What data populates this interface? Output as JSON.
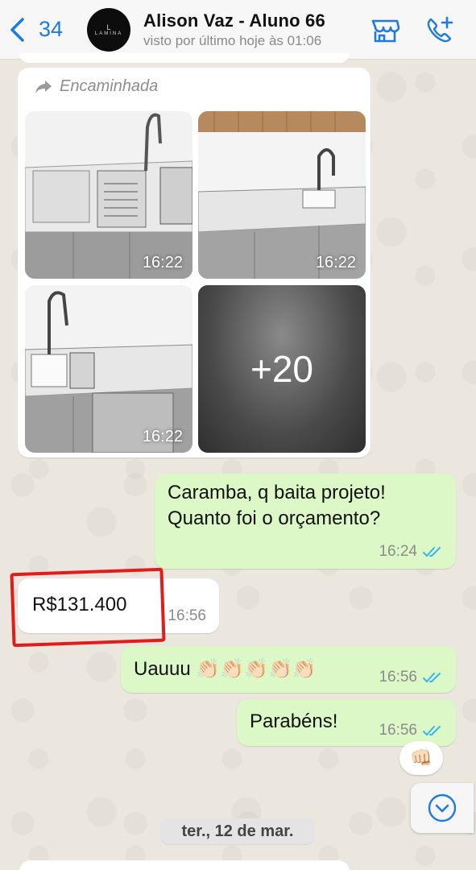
{
  "header": {
    "back_count": "34",
    "contact_name": "Alison Vaz - Aluno 66",
    "status": "visto por último hoje às 01:06",
    "avatar_mark": "L",
    "avatar_brand": "LAMINA",
    "icons": [
      "back-chevron-icon",
      "store-icon",
      "add-call-icon"
    ],
    "accent": "#1c7be0"
  },
  "forwarded": {
    "label": "Encaminhada",
    "images": [
      {
        "time": "16:22"
      },
      {
        "time": "16:22"
      },
      {
        "time": "16:22"
      }
    ],
    "more_label": "+20"
  },
  "messages": [
    {
      "dir": "out",
      "lines": [
        "Caramba, q baita projeto!",
        "Quanto foi o orçamento?"
      ],
      "time": "16:24",
      "read": true
    },
    {
      "dir": "in",
      "text": "R$131.400",
      "time": "16:56"
    },
    {
      "dir": "out",
      "text": "Uauuu 👏🏻👏🏻👏🏻👏🏻👏🏻",
      "time": "16:56",
      "read": true
    },
    {
      "dir": "out",
      "text": "Parabéns!",
      "time": "16:56",
      "read": true,
      "reaction": "👊🏻"
    }
  ],
  "date_separator": "ter., 12 de mar.",
  "colors": {
    "outgoing_bubble": "#dcf8c6",
    "incoming_bubble": "#ffffff",
    "read_ticks": "#34b7f1",
    "highlight": "#e21b1b"
  }
}
